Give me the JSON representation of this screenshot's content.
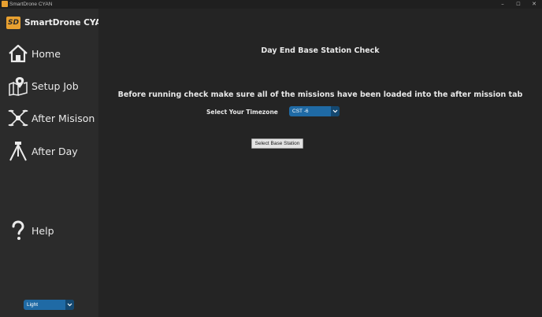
{
  "window": {
    "title": "SmartDrone CYAN",
    "controls": {
      "minimize": "–",
      "maximize": "☐",
      "close": "✕"
    }
  },
  "sidebar": {
    "logo_text": "SmartDrone CYAN",
    "logo_mark": "SD",
    "items": [
      {
        "label": "Home",
        "icon": "home-icon"
      },
      {
        "label": "Setup Job",
        "icon": "map-pin-icon"
      },
      {
        "label": "After Misison",
        "icon": "drone-icon"
      },
      {
        "label": "After Day",
        "icon": "tripod-icon"
      },
      {
        "label": "Help",
        "icon": "question-icon"
      }
    ],
    "theme_select": {
      "value": "Light"
    }
  },
  "main": {
    "page_title": "Day End Base Station Check",
    "instruction": "Before running check make sure all of the missions have been loaded into the after mission tab",
    "timezone_label": "Select Your Timezone",
    "timezone_select": {
      "value": "CST -6"
    },
    "select_base_station_button": "Select Base Station"
  },
  "colors": {
    "accent": "#1f6aa5",
    "accent_dark": "#144870",
    "sidebar_bg": "#2b2b2b",
    "main_bg": "#242424",
    "logo": "#e8a030"
  }
}
